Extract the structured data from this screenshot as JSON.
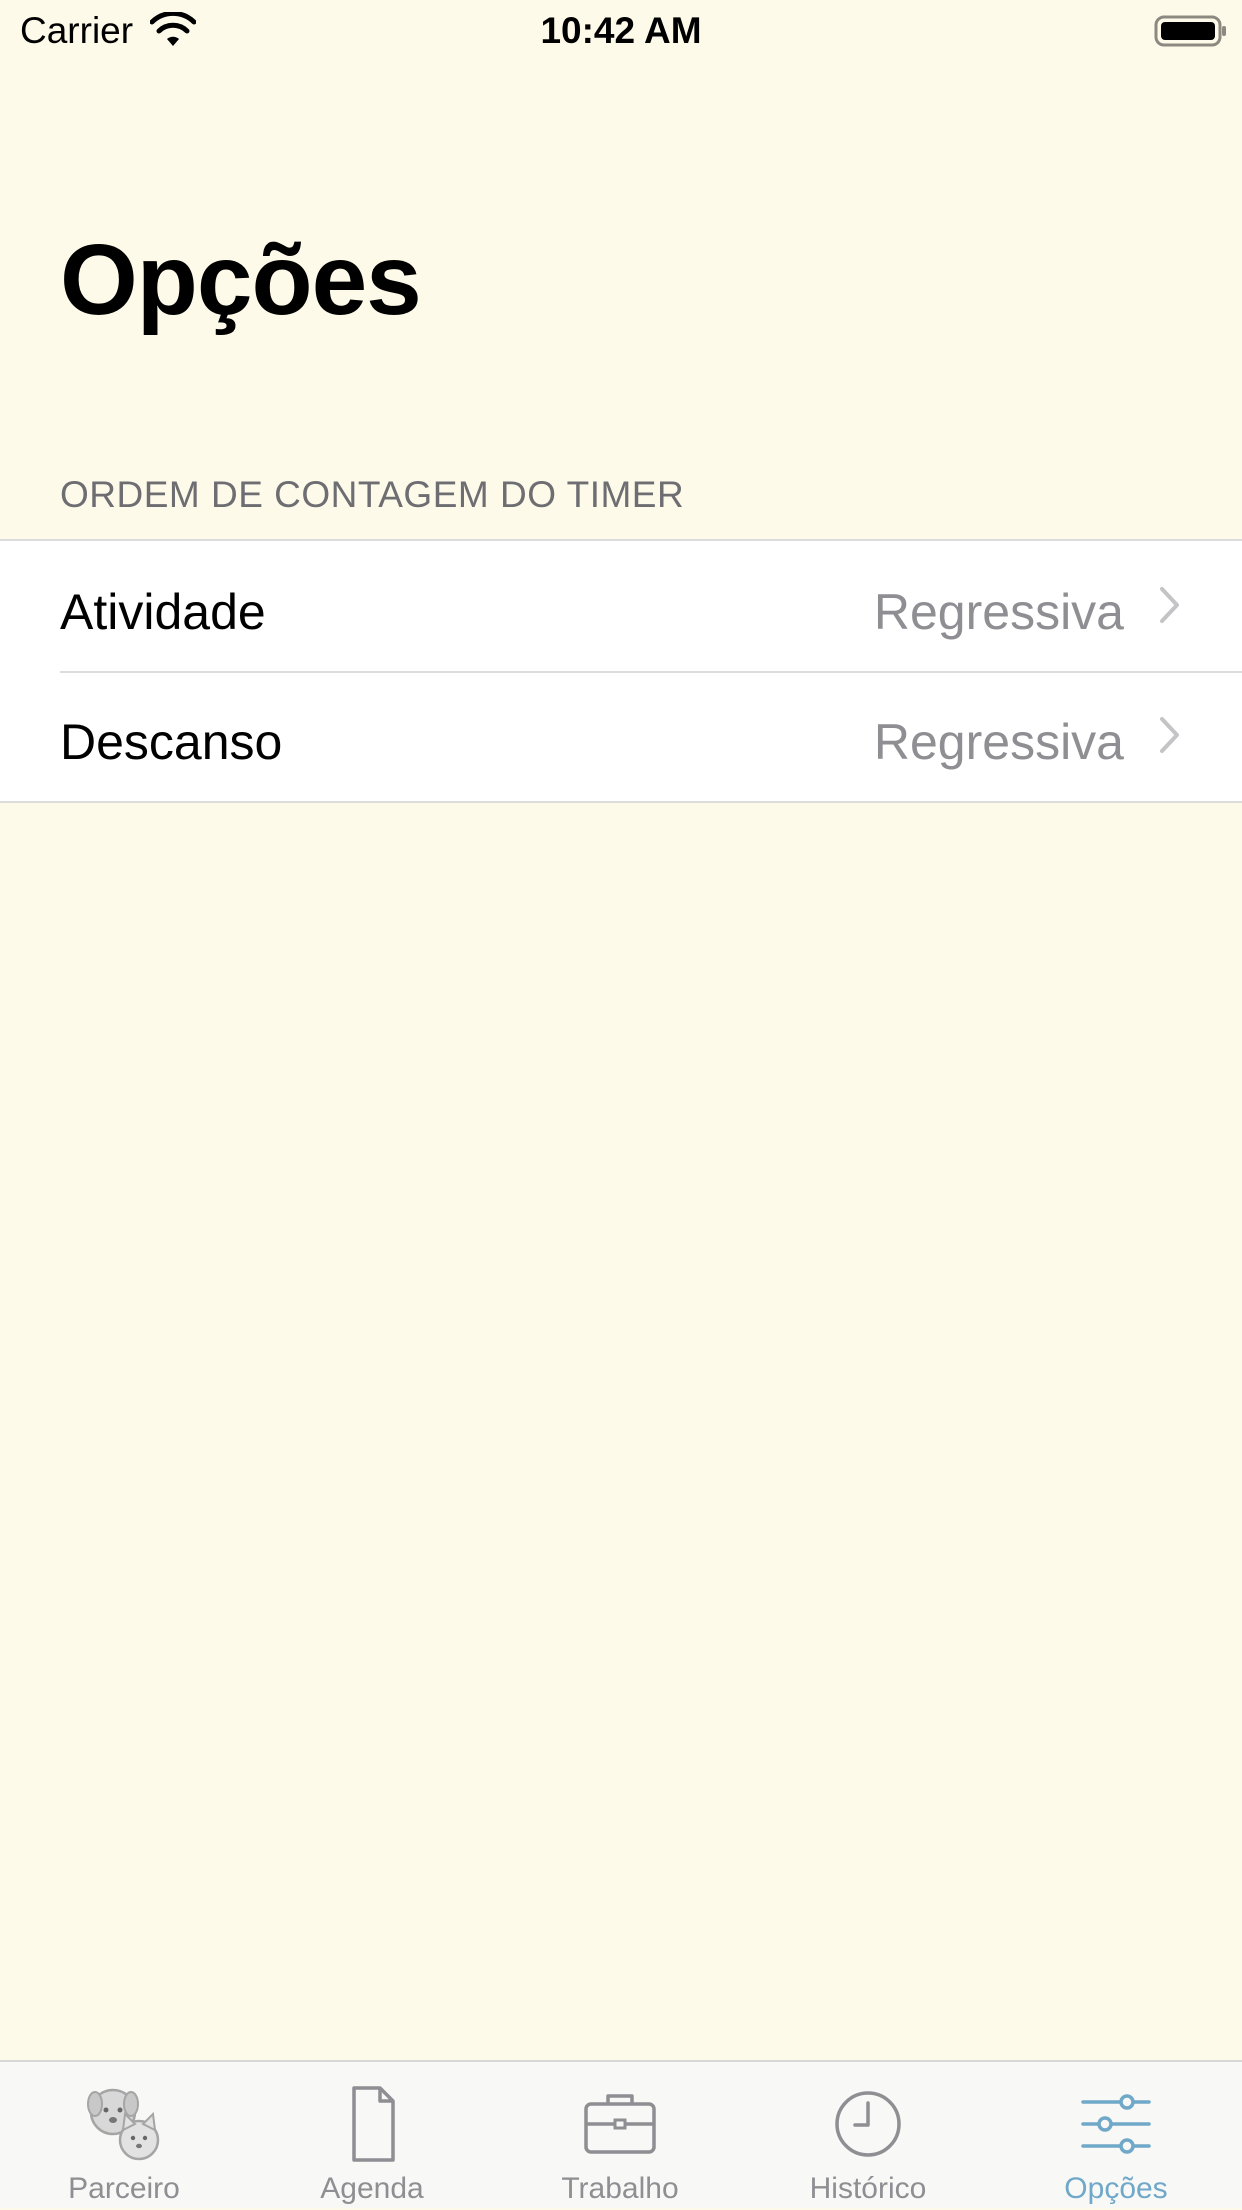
{
  "status_bar": {
    "carrier": "Carrier",
    "time": "10:42 AM",
    "wifi_icon": "wifi-icon",
    "battery_icon": "battery-icon"
  },
  "page": {
    "title": "Opções"
  },
  "section": {
    "header": "ORDEM DE CONTAGEM DO TIMER",
    "rows": [
      {
        "label": "Atividade",
        "value": "Regressiva",
        "icon": "chevron-right-icon"
      },
      {
        "label": "Descanso",
        "value": "Regressiva",
        "icon": "chevron-right-icon"
      }
    ]
  },
  "tab_bar": {
    "tabs": [
      {
        "label": "Parceiro",
        "icon": "pets-icon",
        "active": false
      },
      {
        "label": "Agenda",
        "icon": "document-icon",
        "active": false
      },
      {
        "label": "Trabalho",
        "icon": "briefcase-icon",
        "active": false
      },
      {
        "label": "Histórico",
        "icon": "clock-icon",
        "active": false
      },
      {
        "label": "Opções",
        "icon": "sliders-icon",
        "active": true
      }
    ]
  },
  "colors": {
    "background": "#FDFAE9",
    "accent": "#6FA8C8",
    "secondary_text": "#8E8E93",
    "section_header": "#6D6D72",
    "tab_inactive": "#8E8E93"
  }
}
